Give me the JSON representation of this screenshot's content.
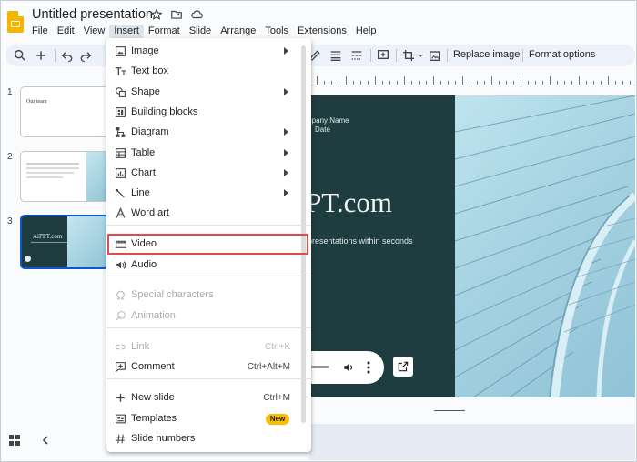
{
  "app": {
    "title": "Untitled presentation",
    "accent": "#0b57d0",
    "logo_color": "#f4b400"
  },
  "menubar": [
    "File",
    "Edit",
    "View",
    "Insert",
    "Format",
    "Slide",
    "Arrange",
    "Tools",
    "Extensions",
    "Help"
  ],
  "menubar_active": "Insert",
  "toolbar": {
    "replace_image": "Replace image",
    "format_options": "Format options"
  },
  "slides": [
    {
      "number": "1",
      "heading": "Our team"
    },
    {
      "number": "2"
    },
    {
      "number": "3",
      "title": "AiPPT.com",
      "selected": true
    }
  ],
  "canvas": {
    "company_name": "mpany Name",
    "date": "Date",
    "title_fragment": "PT.com",
    "subtitle_fragment": "presentations within seconds"
  },
  "insert_menu": {
    "items": [
      {
        "label": "Image",
        "icon": "image-icon",
        "submenu": true
      },
      {
        "label": "Text box",
        "icon": "text-box-icon"
      },
      {
        "label": "Shape",
        "icon": "shape-icon",
        "submenu": true
      },
      {
        "label": "Building blocks",
        "icon": "building-blocks-icon"
      },
      {
        "label": "Diagram",
        "icon": "diagram-icon",
        "submenu": true
      },
      {
        "label": "Table",
        "icon": "table-icon",
        "submenu": true
      },
      {
        "label": "Chart",
        "icon": "chart-icon",
        "submenu": true
      },
      {
        "label": "Line",
        "icon": "line-icon",
        "submenu": true
      },
      {
        "label": "Word art",
        "icon": "word-art-icon"
      },
      {
        "label": "Video",
        "icon": "video-icon",
        "highlighted": true
      },
      {
        "label": "Audio",
        "icon": "audio-icon"
      },
      {
        "label": "Special characters",
        "icon": "omega-icon",
        "disabled": true
      },
      {
        "label": "Animation",
        "icon": "animation-icon",
        "disabled": true
      },
      {
        "label": "Link",
        "icon": "link-icon",
        "disabled": true,
        "shortcut": "Ctrl+K"
      },
      {
        "label": "Comment",
        "icon": "comment-icon",
        "shortcut": "Ctrl+Alt+M"
      },
      {
        "label": "New slide",
        "icon": "plus-icon",
        "shortcut": "Ctrl+M"
      },
      {
        "label": "Templates",
        "icon": "templates-icon",
        "badge": "New"
      },
      {
        "label": "Slide numbers",
        "icon": "hash-icon"
      }
    ],
    "highlight_color": "#e44a4a"
  }
}
